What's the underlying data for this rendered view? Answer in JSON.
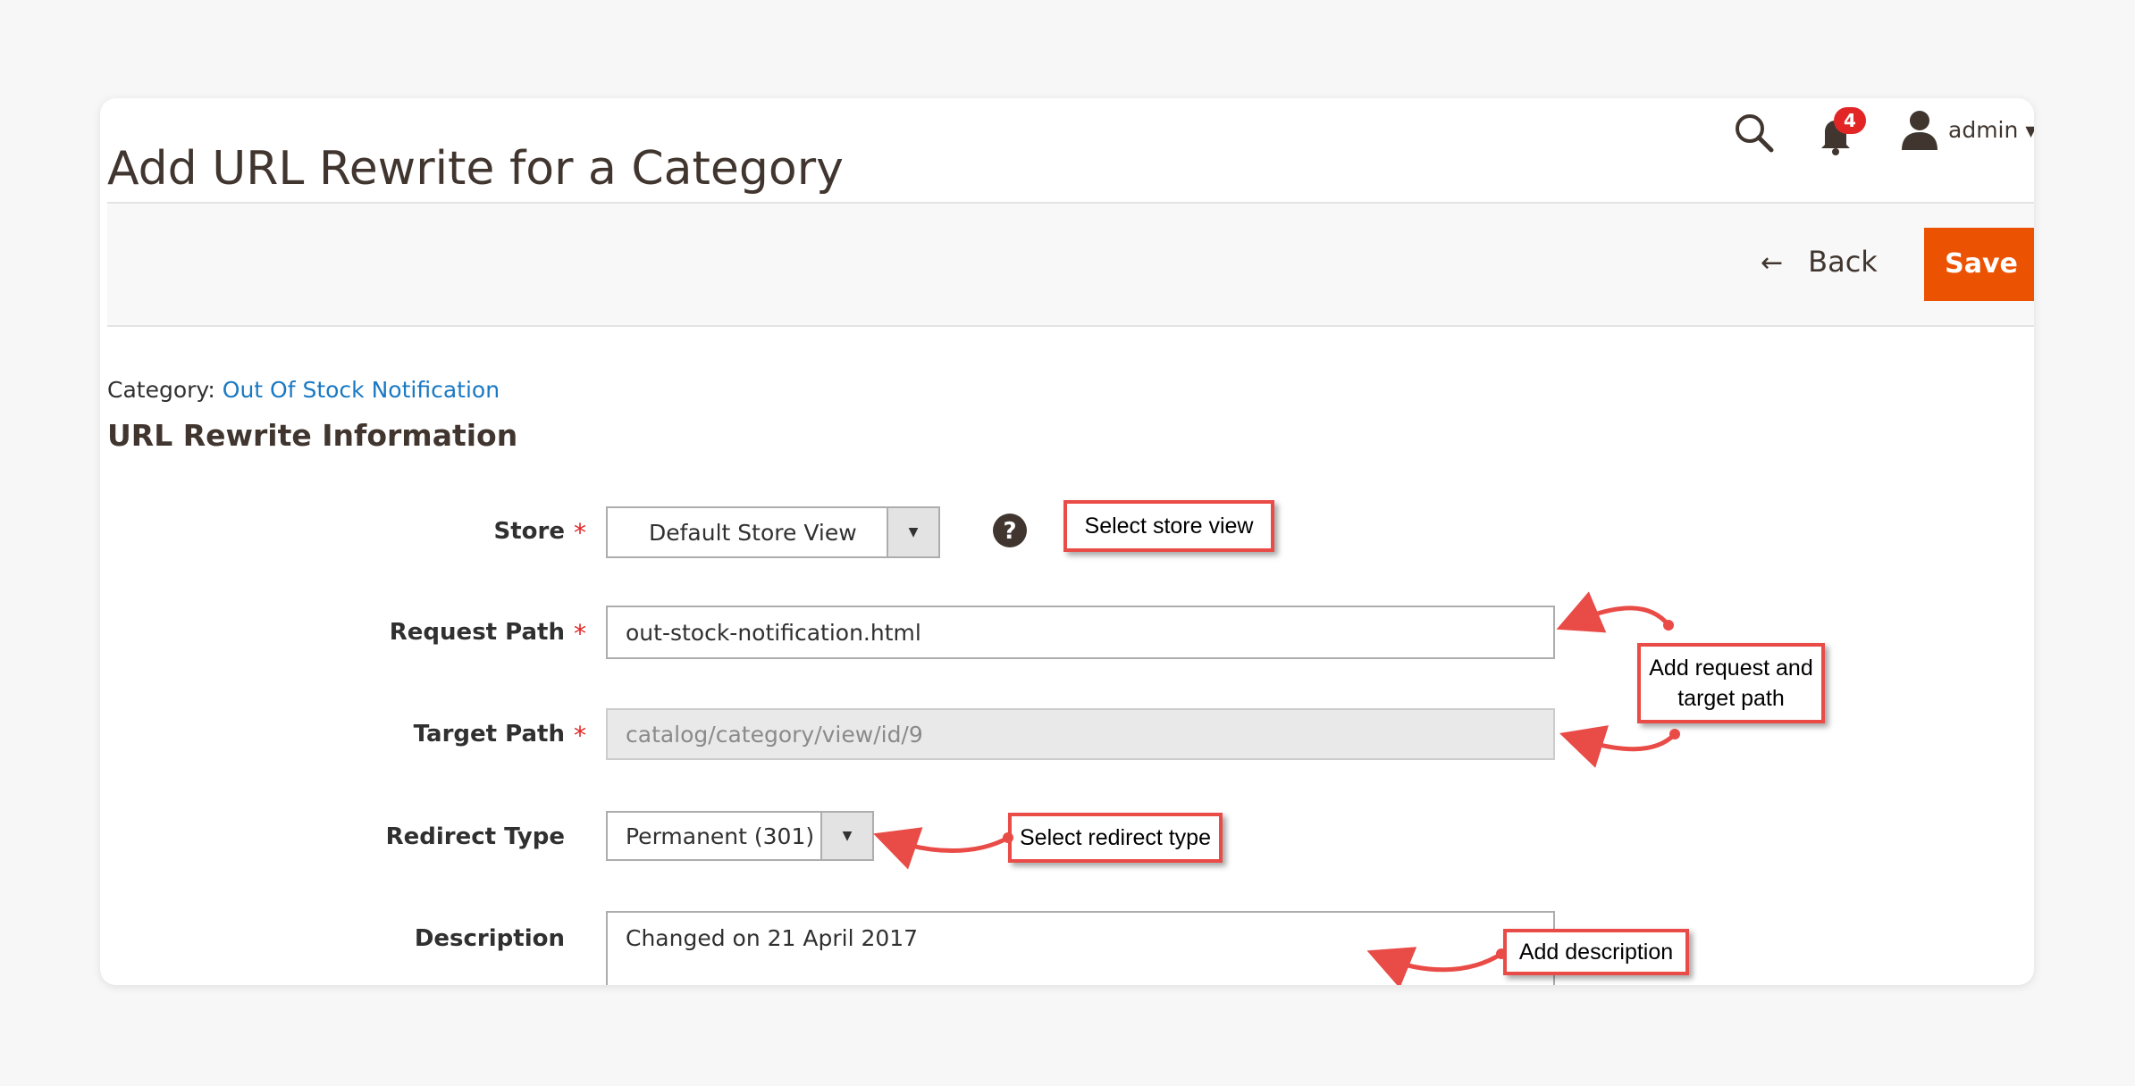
{
  "header": {
    "title": "Add URL Rewrite for a Category",
    "notifications_count": "4",
    "user_name": "admin",
    "icons": [
      "search-icon",
      "bell-icon",
      "user-icon",
      "chevron-down-icon"
    ]
  },
  "actions": {
    "back_label": "Back",
    "save_label": "Save"
  },
  "category": {
    "prefix": "Category:",
    "name": "Out Of Stock Notification"
  },
  "section": {
    "title": "URL Rewrite Information"
  },
  "form": {
    "required_marker": "*",
    "store": {
      "label": "Store",
      "value": "Default Store View"
    },
    "request_path": {
      "label": "Request Path",
      "value": "out-stock-notification.html"
    },
    "target_path": {
      "label": "Target Path",
      "value": "catalog/category/view/id/9"
    },
    "redirect_type": {
      "label": "Redirect Type",
      "value": "Permanent (301)"
    },
    "description": {
      "label": "Description",
      "value": "Changed on 21 April 2017"
    }
  },
  "annotations": {
    "store_view": "Select store view",
    "paths_line1": "Add request and",
    "paths_line2": "target path",
    "redirect_type": "Select redirect type",
    "description": "Add description"
  },
  "colors": {
    "save_button": "#eb5202",
    "link": "#1979c3",
    "required": "#e22626",
    "annotation": "#e94b47"
  }
}
